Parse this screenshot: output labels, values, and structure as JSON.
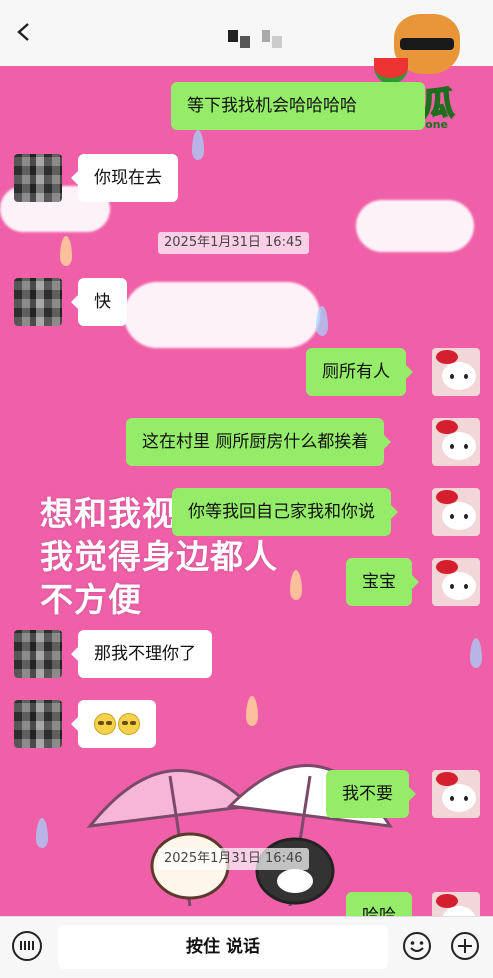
{
  "header": {
    "contact_name": "",
    "back_icon": "chevron-left-icon"
  },
  "watermark": {
    "brand": "1吃瓜",
    "url": "1chigua.one"
  },
  "overlay_text": [
    "想和我视频",
    "我觉得身边都人",
    "不方便"
  ],
  "messages": {
    "m1": "等下我找机会哈哈哈哈",
    "m2": "你现在去",
    "t1": "2025年1月31日 16:45",
    "m3": "快",
    "m4": "厕所有人",
    "m5": "这在村里 厕所厨房什么都挨着",
    "m6": "你等我回自己家我和你说",
    "m7": "宝宝",
    "m8": "那我不理你了",
    "m9": "我不要",
    "t2": "2025年1月31日 16:46",
    "m10": "哈哈"
  },
  "footer": {
    "voice_label": "按住 说话"
  },
  "colors": {
    "wallpaper": "#f060a8",
    "my_bubble": "#95ec69",
    "friend_bubble": "#ffffff"
  }
}
